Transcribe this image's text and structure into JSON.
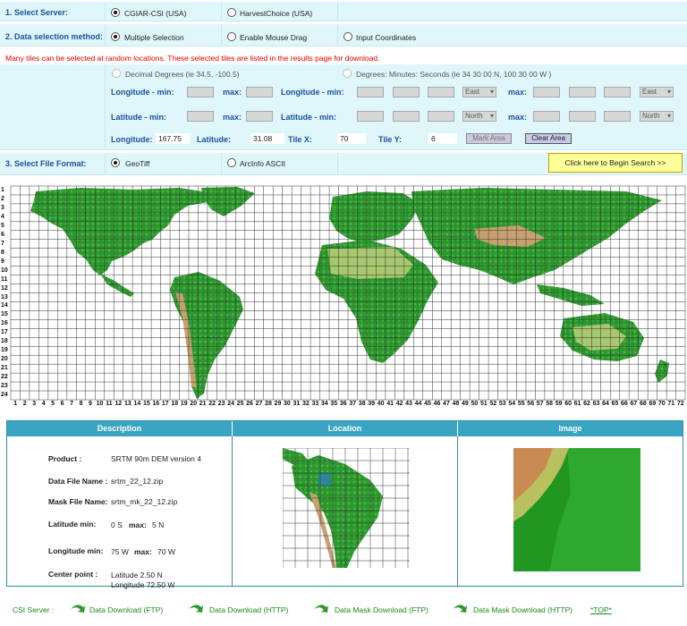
{
  "server": {
    "label": "1. Select Server:",
    "options": [
      "CGIAR-CSI (USA)",
      "HarvestChoice (USA)"
    ],
    "selected": 0
  },
  "method": {
    "label": "2. Data selection method:",
    "options": [
      "Multiple Selection",
      "Enable Mouse Drag",
      "Input Coordinates"
    ],
    "selected": 0
  },
  "warning": "Many tiles can be selected at random locations. These selected tiles are listed in the results page for download.",
  "coords": {
    "decimal_label": "Decimal Degrees (ie 34.5, -100.5)",
    "dms_label": "Degrees: Minutes: Seconds (ie 34 30 00 N, 100 30 00 W )",
    "lon_min": "Longitude - min:",
    "lat_min": "Latitude - min:",
    "max": "max:",
    "east": "East",
    "north": "North"
  },
  "readout": {
    "lon_label": "Longitude:",
    "lon_value": "167.75",
    "lat_label": "Latitude:",
    "lat_value": "31.08",
    "tilex_label": "Tile X:",
    "tilex_value": "70",
    "tiley_label": "Tile Y:",
    "tiley_value": "6",
    "mark_area": "Mark Area",
    "clear_area": "Clear Area"
  },
  "format": {
    "label": "3. Select File Format:",
    "options": [
      "GeoTiff",
      "ArcInfo ASCII"
    ],
    "selected": 0,
    "search_button": "Click here to Begin Search >>"
  },
  "grid": {
    "cols": 72,
    "rows": 24
  },
  "results": {
    "headers": [
      "Description",
      "Location",
      "Image"
    ],
    "product_label": "Product :",
    "product_value": "SRTM 90m DEM version 4",
    "datafile_label": "Data File Name :",
    "datafile_value": "srtm_22_12.zip",
    "maskfile_label": "Mask File Name:",
    "maskfile_value": "srtm_mk_22_12.zip",
    "latmin_label": "Latitude min:",
    "latmin_value": "0 S",
    "latmax_label": "max:",
    "latmax_value": "5 N",
    "lonmin_label": "Longitude min:",
    "lonmin_value": "75 W",
    "lonmax_label": "max:",
    "lonmax_value": "70 W",
    "center_label": "Center point :",
    "center_lat": "Latitude 2.50 N",
    "center_lon": "Longitude 72.50 W"
  },
  "footer": {
    "server_label": "CSI Server :",
    "links": [
      "Data Download (FTP)",
      "Data Download (HTTP)",
      "Data Mask Download (FTP)",
      "Data Mask Download (HTTP)"
    ],
    "top": "*TOP*"
  },
  "colors": {
    "band": "#dff7fb",
    "label_blue": "#1c4f9e",
    "header_teal": "#3aa5c2",
    "land_green": "#2f9a2f",
    "highland": "#c8a070",
    "search_yellow": "#ffff99",
    "warning_red": "#e00000"
  }
}
